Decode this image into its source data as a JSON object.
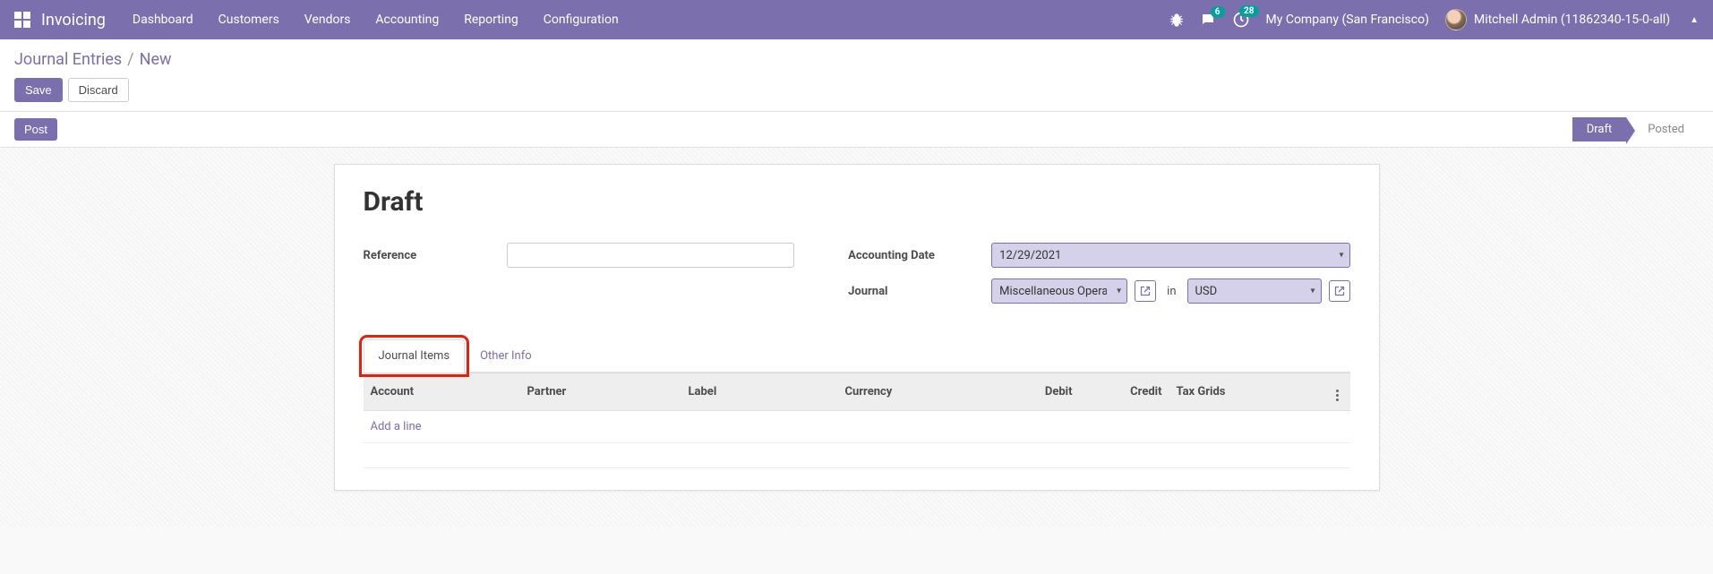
{
  "topbar": {
    "app_title": "Invoicing",
    "menu": [
      "Dashboard",
      "Customers",
      "Vendors",
      "Accounting",
      "Reporting",
      "Configuration"
    ],
    "chat_count": "6",
    "activity_count": "28",
    "company": "My Company (San Francisco)",
    "user": "Mitchell Admin (11862340-15-0-all)"
  },
  "breadcrumb": {
    "parent": "Journal Entries",
    "current": "New"
  },
  "actions": {
    "save": "Save",
    "discard": "Discard",
    "post": "Post"
  },
  "statusbar": {
    "draft": "Draft",
    "posted": "Posted"
  },
  "form": {
    "title": "Draft",
    "labels": {
      "reference": "Reference",
      "accounting_date": "Accounting Date",
      "journal": "Journal",
      "in": "in"
    },
    "values": {
      "reference": "",
      "accounting_date": "12/29/2021",
      "journal": "Miscellaneous Operatio",
      "currency": "USD"
    }
  },
  "tabs": {
    "journal_items": "Journal Items",
    "other_info": "Other Info"
  },
  "table": {
    "headers": {
      "account": "Account",
      "partner": "Partner",
      "label": "Label",
      "currency": "Currency",
      "debit": "Debit",
      "credit": "Credit",
      "tax_grids": "Tax Grids"
    },
    "add_line": "Add a line"
  }
}
